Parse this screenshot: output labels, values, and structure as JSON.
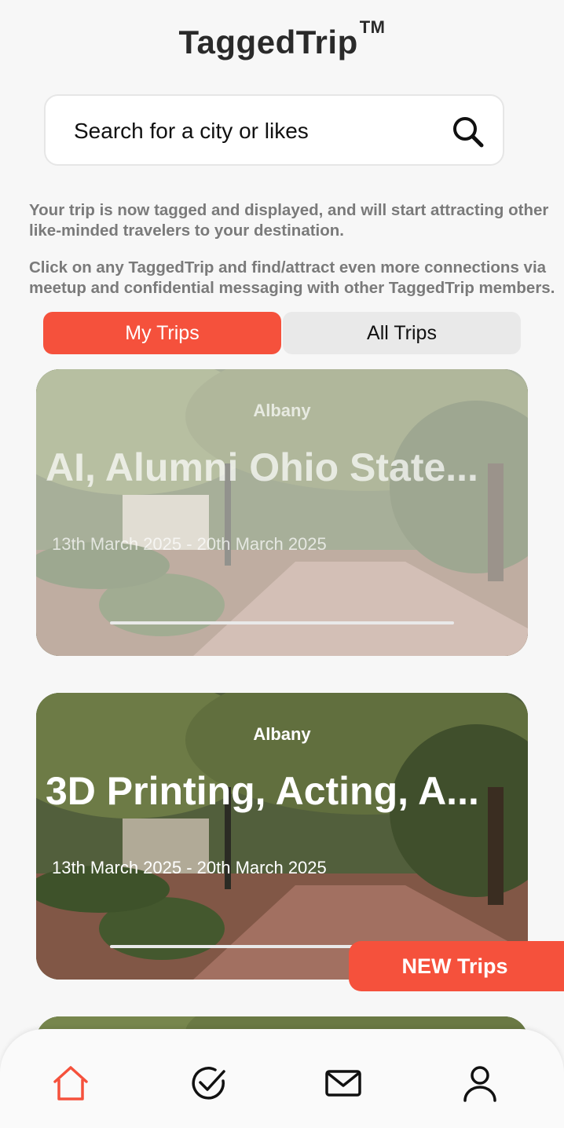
{
  "app": {
    "title": "TaggedTrip",
    "trademark": "TM"
  },
  "search": {
    "placeholder": "Search for a city or likes"
  },
  "info": {
    "paragraph1": "Your trip is now tagged and displayed, and will start attracting other like-minded travelers to your destination.",
    "paragraph2": "Click on any TaggedTrip and find/attract even more connections via meetup and confidential messaging with other TaggedTrip members."
  },
  "tabs": {
    "my_trips": "My Trips",
    "all_trips": "All Trips",
    "active": "My Trips"
  },
  "trips": [
    {
      "city": "Albany",
      "title": "AI, Alumni Ohio State...",
      "dates": "13th March 2025 - 20th March 2025"
    },
    {
      "city": "Albany",
      "title": "3D Printing, Acting, A...",
      "dates": "13th March 2025 - 20th March 2025"
    }
  ],
  "new_trips_button": "NEW Trips",
  "nav": {
    "items": [
      "home-icon",
      "check-circle-icon",
      "mail-icon",
      "profile-icon"
    ],
    "active": "home-icon",
    "accent": "#f5513c"
  },
  "colors": {
    "accent": "#f5513c",
    "muted_text": "#7a7a7a"
  }
}
